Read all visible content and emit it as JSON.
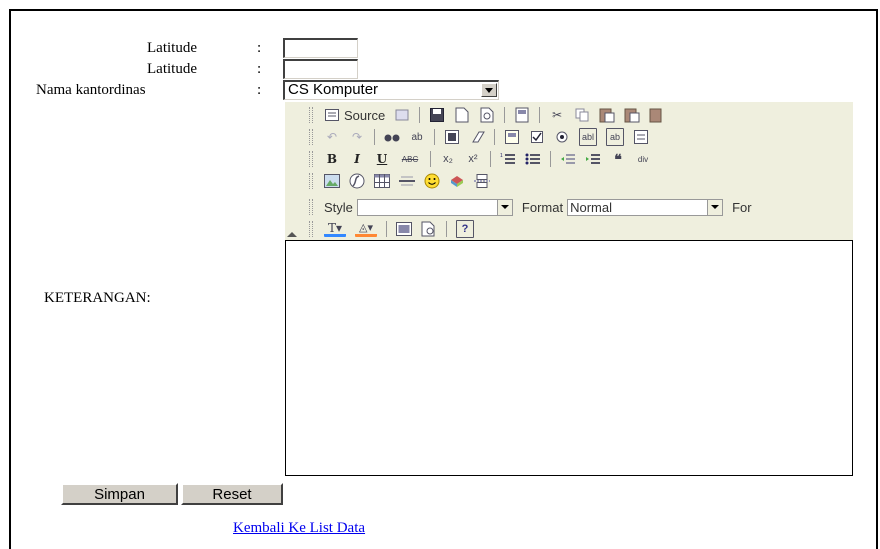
{
  "form": {
    "latitude_label": "Latitude",
    "latitude2_label": "Latitude",
    "kantor_label": "Nama kantordinas",
    "colon": ":",
    "kantor_selected": "CS Komputer",
    "keterangan_label": "KETERANGAN:",
    "latitude_value": "",
    "latitude2_value": ""
  },
  "editor": {
    "source_label": "Source",
    "style_label": "Style",
    "style_value": "",
    "format_label": "Format",
    "format_value": "Normal",
    "font_label_partial": "For",
    "toolbar_bg": "#efefde",
    "icons": {
      "row1": [
        "source-icon",
        "preview-doc-icon",
        "save-icon",
        "new-page-icon",
        "print-preview-icon",
        "templates-icon",
        "cut-icon",
        "copy-icon",
        "paste-icon",
        "paste-text-icon",
        "paste-word-icon"
      ],
      "row2": [
        "undo-icon",
        "redo-icon",
        "find-icon",
        "replace-icon",
        "select-all-icon",
        "remove-format-icon",
        "form-icon",
        "checkbox-icon",
        "radio-icon",
        "text-field-icon",
        "textarea-icon",
        "select-field-icon"
      ],
      "row3": [
        "bold-icon",
        "italic-icon",
        "underline-icon",
        "strikethrough-icon",
        "subscript-icon",
        "superscript-icon",
        "numbered-list-icon",
        "bulleted-list-icon",
        "outdent-icon",
        "indent-icon",
        "blockquote-icon",
        "div-icon"
      ],
      "row4": [
        "image-icon",
        "flash-icon",
        "table-icon",
        "horizontal-rule-icon",
        "smiley-icon",
        "special-char-icon",
        "page-break-icon"
      ],
      "row6": [
        "text-color-icon",
        "bg-color-icon",
        "maximize-icon",
        "show-blocks-icon",
        "about-icon"
      ]
    },
    "glyphs": {
      "bold": "B",
      "italic": "I",
      "underline": "U",
      "strike": "ABC"
    }
  },
  "buttons": {
    "simpan": "Simpan",
    "reset": "Reset"
  },
  "links": {
    "back": "Kembali Ke List Data"
  }
}
